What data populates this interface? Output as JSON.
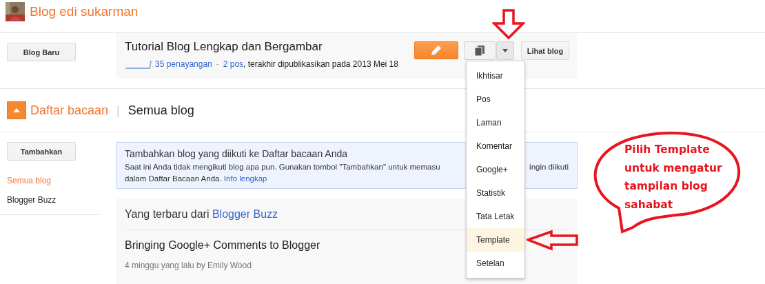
{
  "header": {
    "title": "Blog edi sukarman"
  },
  "blog_sidebar": {
    "new_blog_button": "Blog Baru"
  },
  "blog": {
    "title": "Tutorial Blog Lengkap dan Bergambar",
    "views": "35 penayangan",
    "separator": "-",
    "posts": "2 pos",
    "last_published": ", terakhir dipublikasikan pada 2013 Mei 18",
    "view_button": "Lihat blog"
  },
  "menu": {
    "items": [
      {
        "label": "Ikhtisar",
        "selected": false
      },
      {
        "label": "Pos",
        "selected": false
      },
      {
        "label": "Laman",
        "selected": false
      },
      {
        "label": "Komentar",
        "selected": false
      },
      {
        "label": "Google+",
        "selected": false
      },
      {
        "label": "Statistik",
        "selected": false
      },
      {
        "label": "Tata Letak",
        "selected": false
      },
      {
        "label": "Template",
        "selected": true
      },
      {
        "label": "Setelan",
        "selected": false
      }
    ]
  },
  "reading_list": {
    "title": "Daftar bacaan",
    "divider": "|",
    "filter": "Semua blog",
    "expanded": true,
    "add_button": "Tambahkan",
    "items": [
      {
        "label": "Semua blog",
        "selected": true
      },
      {
        "label": "Blogger Buzz",
        "selected": false
      }
    ],
    "notice": {
      "title": "Tambahkan blog yang diikuti ke Daftar bacaan Anda",
      "line1_left": "Saat ini Anda tidak mengikuti blog apa pun. Gunakan tombol \"Tambahkan\" untuk memasu",
      "line1_right": "ingin diikuti",
      "line2": "dalam Daftar Bacaan Anda.",
      "link": "Info lengkap"
    },
    "feed": {
      "heading": "Yang terbaru dari",
      "source": "Blogger Buzz",
      "post_title": "Bringing Google+ Comments to Blogger",
      "meta": "4 minggu yang lalu by Emily Wood"
    }
  },
  "annotation": {
    "lines": [
      "Pilih Template",
      "untuk mengatur",
      "tampilan blog",
      "sahabat"
    ]
  }
}
